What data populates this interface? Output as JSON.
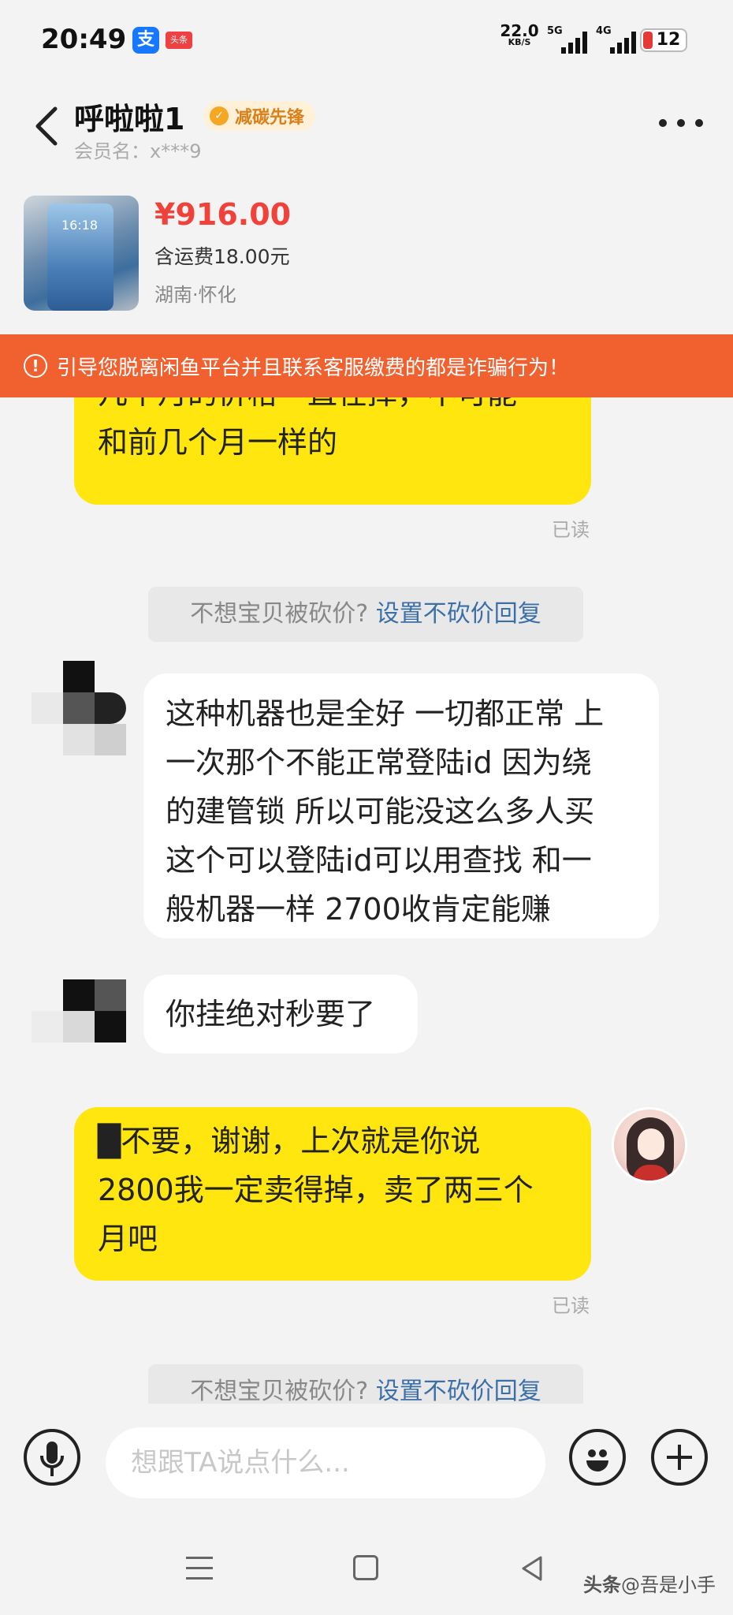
{
  "status_bar": {
    "time": "20:49",
    "net_speed_value": "22.0",
    "net_speed_unit": "KB/S",
    "signal_1": "5G",
    "signal_2": "4G",
    "battery": "12",
    "alipay_icon_char": "支",
    "toutiao_icon_text": "头条"
  },
  "header": {
    "title": "呼啦啦1",
    "badge": "减碳先锋",
    "member": "会员名：x***9"
  },
  "product": {
    "price": "¥916.00",
    "shipping": "含运费18.00元",
    "location": "湖南·怀化",
    "thumb_clock": "16:18"
  },
  "warning": {
    "icon": "!",
    "text": "引导您脱离闲鱼平台并且联系客服缴费的都是诈骗行为！"
  },
  "messages": [
    {
      "direction": "out",
      "text": "几个月的价格一直在掉，不可能和前几个月一样的",
      "lines": [
        "几个月的价格一直在掉，不可能",
        "和前几个月一样的"
      ],
      "status": "已读"
    },
    {
      "type": "system",
      "text": "不想宝贝被砍价?",
      "link": "设置不砍价回复"
    },
    {
      "direction": "in",
      "lines": [
        "这种机器也是全好 一切都正常 上",
        "一次那个不能正常登陆id 因为绕",
        "的建管锁 所以可能没这么多人买",
        "这个可以登陆id可以用查找 和一",
        "般机器一样 2700收肯定能赚"
      ]
    },
    {
      "direction": "in",
      "lines": [
        "你挂绝对秒要了"
      ]
    },
    {
      "direction": "out",
      "lines": [
        "█不要，谢谢，上次就是你说",
        "2800我一定卖得掉，卖了两三个",
        "月吧"
      ],
      "status": "已读"
    },
    {
      "type": "system",
      "text": "不想宝贝被砍价?",
      "link": "设置不砍价回复"
    }
  ],
  "input": {
    "placeholder": "想跟TA说点什么..."
  },
  "watermark": {
    "brand": "头条",
    "author": "@吾是小手"
  },
  "colors": {
    "accent_yellow": "#ffe60f",
    "price_red": "#f0423a",
    "warning_orange": "#f0612f",
    "link_blue": "#3b6fa8"
  }
}
